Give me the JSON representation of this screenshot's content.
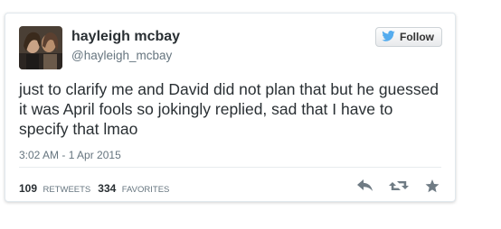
{
  "user": {
    "display_name": "hayleigh mcbay",
    "handle": "@hayleigh_mcbay",
    "avatar_icon": "profile-photo"
  },
  "follow_button": {
    "label": "Follow",
    "icon": "twitter-bird-icon",
    "bird_color": "#55acee"
  },
  "tweet": {
    "text": "just to clarify me and David did not plan that but he guessed it was April fools so jokingly replied, sad that I have to specify that lmao",
    "timestamp": "3:02 AM - 1 Apr 2015"
  },
  "stats": {
    "retweets_count": "109",
    "retweets_label": "RETWEETS",
    "favorites_count": "334",
    "favorites_label": "FAVORITES"
  },
  "actions": {
    "reply_icon": "reply-icon",
    "retweet_icon": "retweet-icon",
    "favorite_icon": "star-icon",
    "icon_color": "#6f7b84"
  }
}
